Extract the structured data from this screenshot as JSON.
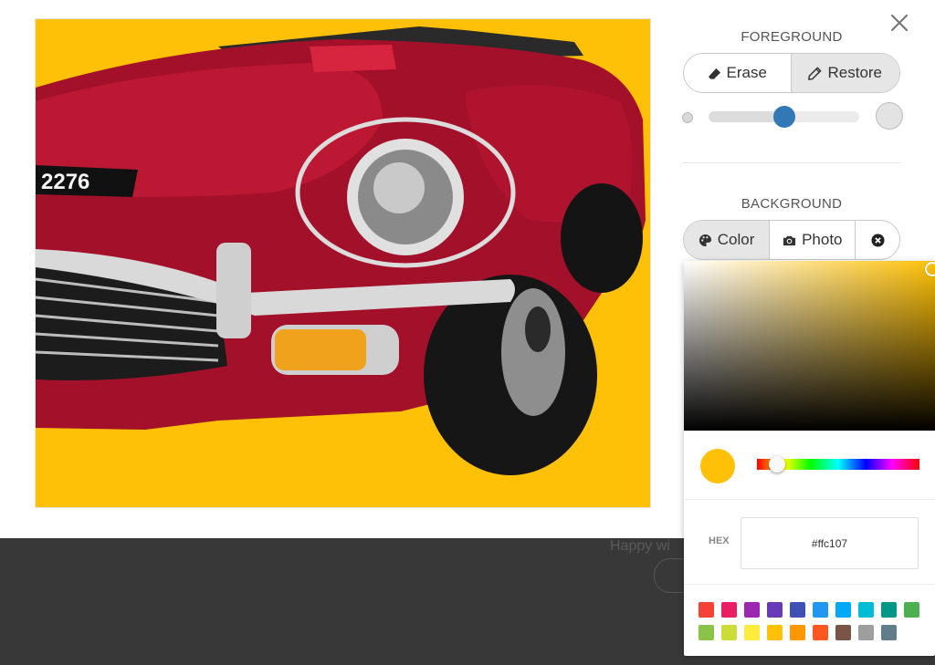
{
  "panel": {
    "close_icon": "close-icon",
    "foreground": {
      "title": "FOREGROUND",
      "erase_label": "Erase",
      "restore_label": "Restore",
      "active": "restore",
      "brush_size_fraction": 0.5
    },
    "background": {
      "title": "BACKGROUND",
      "color_label": "Color",
      "photo_label": "Photo",
      "active": "color"
    }
  },
  "canvas": {
    "background_color": "#ffc107",
    "plate_text": "2276"
  },
  "color_picker": {
    "current_color": "#ffc107",
    "hue_fraction": 0.125,
    "hex_label": "HEX",
    "hex_value": "#ffc107",
    "swatches": [
      "#f44336",
      "#e91e63",
      "#9c27b0",
      "#673ab7",
      "#3f51b5",
      "#2196f3",
      "#03a9f4",
      "#00bcd4",
      "#009688",
      "#4caf50",
      "#8bc34a",
      "#cddc39",
      "#ffeb3b",
      "#ffc107",
      "#ff9800",
      "#ff5722",
      "#795548",
      "#9e9e9e",
      "#607d8b"
    ]
  },
  "footer": {
    "partial_text": "Happy wi"
  }
}
